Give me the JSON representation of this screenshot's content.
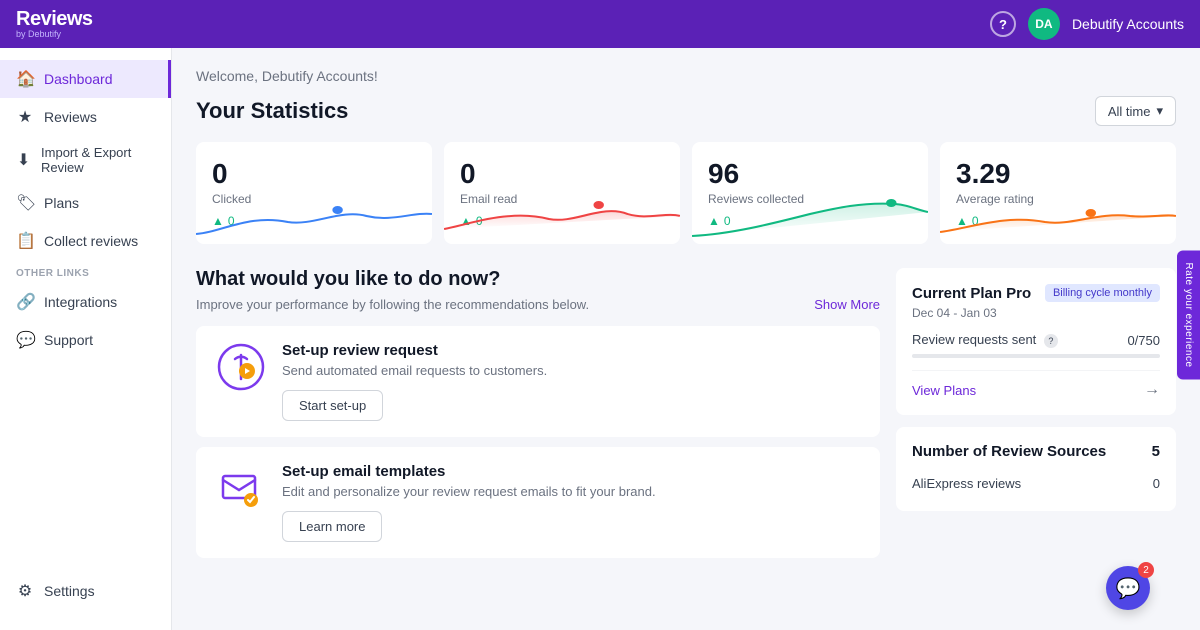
{
  "header": {
    "logo": "Reviews",
    "logo_by": "by Debutify",
    "help_label": "?",
    "avatar_initials": "DA",
    "account_name": "Debutify Accounts"
  },
  "sidebar": {
    "main_items": [
      {
        "id": "dashboard",
        "label": "Dashboard",
        "icon": "🏠",
        "active": true
      },
      {
        "id": "reviews",
        "label": "Reviews",
        "icon": "★",
        "active": false
      },
      {
        "id": "import-export",
        "label": "Import & Export Review",
        "icon": "⬇",
        "active": false
      },
      {
        "id": "plans",
        "label": "Plans",
        "icon": "🏷",
        "active": false
      },
      {
        "id": "collect-reviews",
        "label": "Collect reviews",
        "icon": "📋",
        "active": false
      }
    ],
    "other_links_label": "OTHER LINKS",
    "other_items": [
      {
        "id": "integrations",
        "label": "Integrations",
        "icon": "🔗",
        "active": false
      },
      {
        "id": "support",
        "label": "Support",
        "icon": "💬",
        "active": false
      }
    ],
    "bottom_items": [
      {
        "id": "settings",
        "label": "Settings",
        "icon": "⚙"
      }
    ]
  },
  "main": {
    "welcome": "Welcome, Debutify Accounts!",
    "stats_title": "Your Statistics",
    "filter_label": "All time",
    "stats": [
      {
        "id": "clicked",
        "value": "0",
        "label": "Clicked",
        "change": "0",
        "change_positive": true,
        "chart_color": "#3b82f6"
      },
      {
        "id": "email-read",
        "value": "0",
        "label": "Email read",
        "change": "0",
        "change_positive": true,
        "chart_color": "#ef4444"
      },
      {
        "id": "reviews-collected",
        "value": "96",
        "label": "Reviews collected",
        "change": "0",
        "change_positive": true,
        "chart_color": "#10b981"
      },
      {
        "id": "average-rating",
        "value": "3.29",
        "label": "Average rating",
        "change": "0",
        "change_positive": true,
        "chart_color": "#f97316"
      }
    ],
    "recommendations_title": "What would you like to do now?",
    "recommendations_subtitle": "Improve your performance by following the recommendations below.",
    "show_more_label": "Show More",
    "recommendations": [
      {
        "id": "setup-review-request",
        "title": "Set-up review request",
        "description": "Send automated email requests to customers.",
        "button_label": "Start set-up"
      },
      {
        "id": "setup-email-templates",
        "title": "Set-up email templates",
        "description": "Edit and personalize your review request emails to fit your brand.",
        "button_label": "Learn more"
      }
    ],
    "plan": {
      "title": "Current Plan Pro",
      "badge": "Billing cycle monthly",
      "dates": "Dec 04 - Jan 03",
      "metric_label": "Review requests sent",
      "metric_value": "0/750",
      "progress_pct": 0,
      "view_plans_label": "View Plans"
    },
    "sources": {
      "title": "Number of Review Sources",
      "count": "5",
      "items": [
        {
          "label": "AliExpress reviews",
          "value": "0"
        }
      ]
    }
  },
  "chat": {
    "badge": "2"
  },
  "rate_sidebar": {
    "label": "Rate your experience"
  }
}
